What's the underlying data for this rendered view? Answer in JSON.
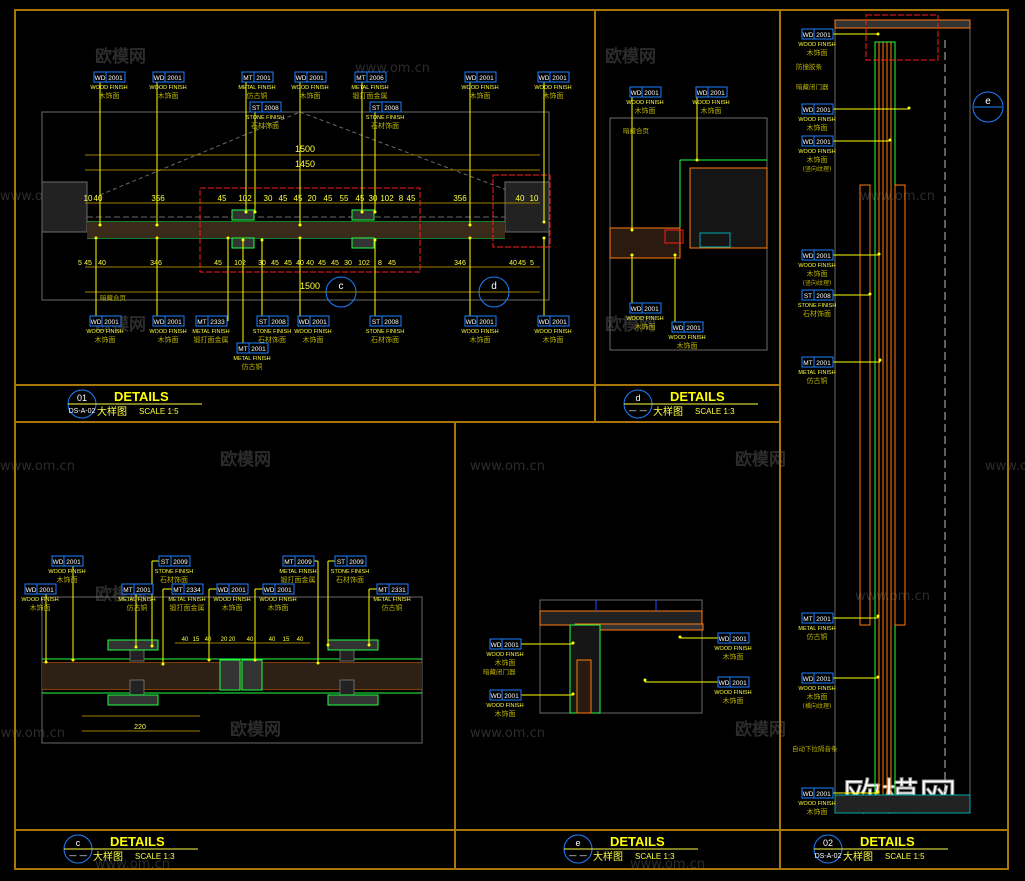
{
  "colors": {
    "frame": "#a8760a",
    "tag_box": "#1e7fff",
    "leader": "#ffff00",
    "dim": "#a08000",
    "green": "#22ff44",
    "orange": "#ff7a10",
    "red": "#ff1a1a",
    "grey": "#6a6a6a",
    "cn_text": "#b8b000"
  },
  "watermarks": {
    "logo": "欧模网",
    "url": "www.om.cn"
  },
  "tags": [
    {
      "code": "WD",
      "num": "2001",
      "finish": "WOOD FINISH",
      "cn": "木饰面"
    },
    {
      "code": "WD",
      "num": "2001",
      "finish": "WOOD FINISH",
      "cn": "木饰面"
    },
    {
      "code": "MT",
      "num": "2001",
      "finish": "METAL FINISH",
      "cn": "仿古铜"
    },
    {
      "code": "WD",
      "num": "2001",
      "finish": "WOOD FINISH",
      "cn": "木饰面"
    },
    {
      "code": "MT",
      "num": "2006",
      "finish": "METAL FINISH",
      "cn": "锻打面金属"
    },
    {
      "code": "WD",
      "num": "2001",
      "finish": "WOOD FINISH",
      "cn": "木饰面"
    },
    {
      "code": "WD",
      "num": "2001",
      "finish": "WOOD FINISH",
      "cn": "木饰面"
    },
    {
      "code": "ST",
      "num": "2008",
      "finish": "STONE FINISH",
      "cn": "石材饰面"
    },
    {
      "code": "ST",
      "num": "2008",
      "finish": "STONE FINISH",
      "cn": "石材饰面"
    },
    {
      "code": "WD",
      "num": "2001",
      "finish": "WOOD FINISH",
      "cn": "木饰面"
    },
    {
      "code": "WD",
      "num": "2001",
      "finish": "WOOD FINISH",
      "cn": "木饰面"
    },
    {
      "code": "MT",
      "num": "2333",
      "finish": "METAL FINISH",
      "cn": "锻打面金属"
    },
    {
      "code": "ST",
      "num": "2008",
      "finish": "STONE FINISH",
      "cn": "石材饰面"
    },
    {
      "code": "WD",
      "num": "2001",
      "finish": "WOOD FINISH",
      "cn": "木饰面"
    },
    {
      "code": "ST",
      "num": "2008",
      "finish": "STONE FINISH",
      "cn": "石材饰面"
    },
    {
      "code": "WD",
      "num": "2001",
      "finish": "WOOD FINISH",
      "cn": "木饰面"
    },
    {
      "code": "WD",
      "num": "2001",
      "finish": "WOOD FINISH",
      "cn": "木饰面"
    },
    {
      "code": "MT",
      "num": "2001",
      "finish": "METAL FINISH",
      "cn": "仿古铜"
    },
    {
      "code": "WD",
      "num": "2001",
      "finish": "WOOD FINISH",
      "cn": "木饰面"
    },
    {
      "code": "WD",
      "num": "2001",
      "finish": "WOOD FINISH",
      "cn": "木饰面"
    },
    {
      "code": "WD",
      "num": "2001",
      "finish": "WOOD FINISH",
      "cn": "木饰面"
    },
    {
      "code": "WD",
      "num": "2001",
      "finish": "WOOD FINISH",
      "cn": "木饰面"
    },
    {
      "code": "WD",
      "num": "2001",
      "finish": "WOOD FINISH",
      "cn": "木饰面"
    },
    {
      "code": "WD",
      "num": "2001",
      "finish": "WOOD FINISH",
      "cn": "木饰面"
    },
    {
      "code": "ST",
      "num": "2009",
      "finish": "STONE FINISH",
      "cn": "石材饰面"
    },
    {
      "code": "MT",
      "num": "2001",
      "finish": "METAL FINISH",
      "cn": "仿古铜"
    },
    {
      "code": "MT",
      "num": "2334",
      "finish": "METAL FINISH",
      "cn": "锻打面金属"
    },
    {
      "code": "WD",
      "num": "2001",
      "finish": "WOOD FINISH",
      "cn": "木饰面"
    },
    {
      "code": "WD",
      "num": "2001",
      "finish": "WOOD FINISH",
      "cn": "木饰面"
    },
    {
      "code": "MT",
      "num": "2009",
      "finish": "METAL FINISH",
      "cn": "锻打面金属"
    },
    {
      "code": "ST",
      "num": "2009",
      "finish": "STONE FINISH",
      "cn": "石材饰面"
    },
    {
      "code": "MT",
      "num": "2331",
      "finish": "METAL FINISH",
      "cn": "仿古铜"
    },
    {
      "code": "WD",
      "num": "2001",
      "finish": "WOOD FINISH",
      "cn": "木饰面"
    },
    {
      "code": "WD",
      "num": "2001",
      "finish": "WOOD FINISH",
      "cn": "木饰面"
    },
    {
      "code": "WD",
      "num": "2001",
      "finish": "WOOD FINISH",
      "cn": "木饰面"
    },
    {
      "code": "WD",
      "num": "2001",
      "finish": "WOOD FINISH",
      "cn": "木饰面"
    },
    {
      "code": "WD",
      "num": "2001",
      "finish": "WOOD FINISH",
      "cn": "木饰面"
    },
    {
      "code": "WD",
      "num": "2001",
      "finish": "WOOD FINISH",
      "cn": "木饰面"
    },
    {
      "code": "WD",
      "num": "2001",
      "finish": "WOOD FINISH",
      "cn": "木饰面",
      "note": "(竖向纹理)"
    },
    {
      "code": "WD",
      "num": "2001",
      "finish": "WOOD FINISH",
      "cn": "木饰面",
      "note": "(竖向纹理)"
    },
    {
      "code": "ST",
      "num": "2008",
      "finish": "STONE FINISH",
      "cn": "石材饰面"
    },
    {
      "code": "MT",
      "num": "2001",
      "finish": "METAL FINISH",
      "cn": "仿古铜"
    },
    {
      "code": "MT",
      "num": "2001",
      "finish": "METAL FINISH",
      "cn": "仿古铜"
    },
    {
      "code": "WD",
      "num": "2001",
      "finish": "WOOD FINISH",
      "cn": "木饰面",
      "note": "(横向纹理)"
    },
    {
      "code": "WD",
      "num": "2001",
      "finish": "WOOD FINISH",
      "cn": "木饰面"
    }
  ],
  "notes": [
    "暗藏合页",
    "暗藏合页",
    "暗藏闭门器",
    "防撞胶条",
    "暗藏闭门器",
    "自动下拉隔音条"
  ],
  "dimensions": {
    "d01_overall_top": "1500",
    "d01_inner": "1450",
    "d01_overall_bottom": "1500",
    "d01_top_row": [
      "10",
      "40",
      "356",
      "45",
      "102",
      "30",
      "45",
      "45",
      "20",
      "45",
      "55",
      "45",
      "30",
      "102",
      "8",
      "45",
      "356",
      "40",
      "10"
    ],
    "d01_bottom_row": [
      "5",
      "45",
      "40",
      "346",
      "45",
      "102",
      "30",
      "45",
      "45",
      "40",
      "40",
      "45",
      "45",
      "30",
      "102",
      "8",
      "45",
      "346",
      "40",
      "45",
      "5"
    ],
    "dc_total": "220",
    "dc_row": [
      "40",
      "15",
      "40",
      "20",
      "20",
      "40",
      "40",
      "15",
      "40"
    ]
  },
  "callouts": [
    "c",
    "d",
    "e"
  ],
  "titles": [
    {
      "num": "01",
      "sheet": "DS-A-02",
      "title": "DETAILS",
      "cn": "大样图",
      "scale": "SCALE  1:5"
    },
    {
      "num": "d",
      "sheet": "",
      "title": "DETAILS",
      "cn": "大样图",
      "scale": "SCALE  1:3"
    },
    {
      "num": "c",
      "sheet": "",
      "title": "DETAILS",
      "cn": "大样图",
      "scale": "SCALE  1:3"
    },
    {
      "num": "e",
      "sheet": "",
      "title": "DETAILS",
      "cn": "大样图",
      "scale": "SCALE  1:3"
    },
    {
      "num": "02",
      "sheet": "DS-A-02",
      "title": "DETAILS",
      "cn": "大样图",
      "scale": "SCALE  1:5"
    }
  ]
}
